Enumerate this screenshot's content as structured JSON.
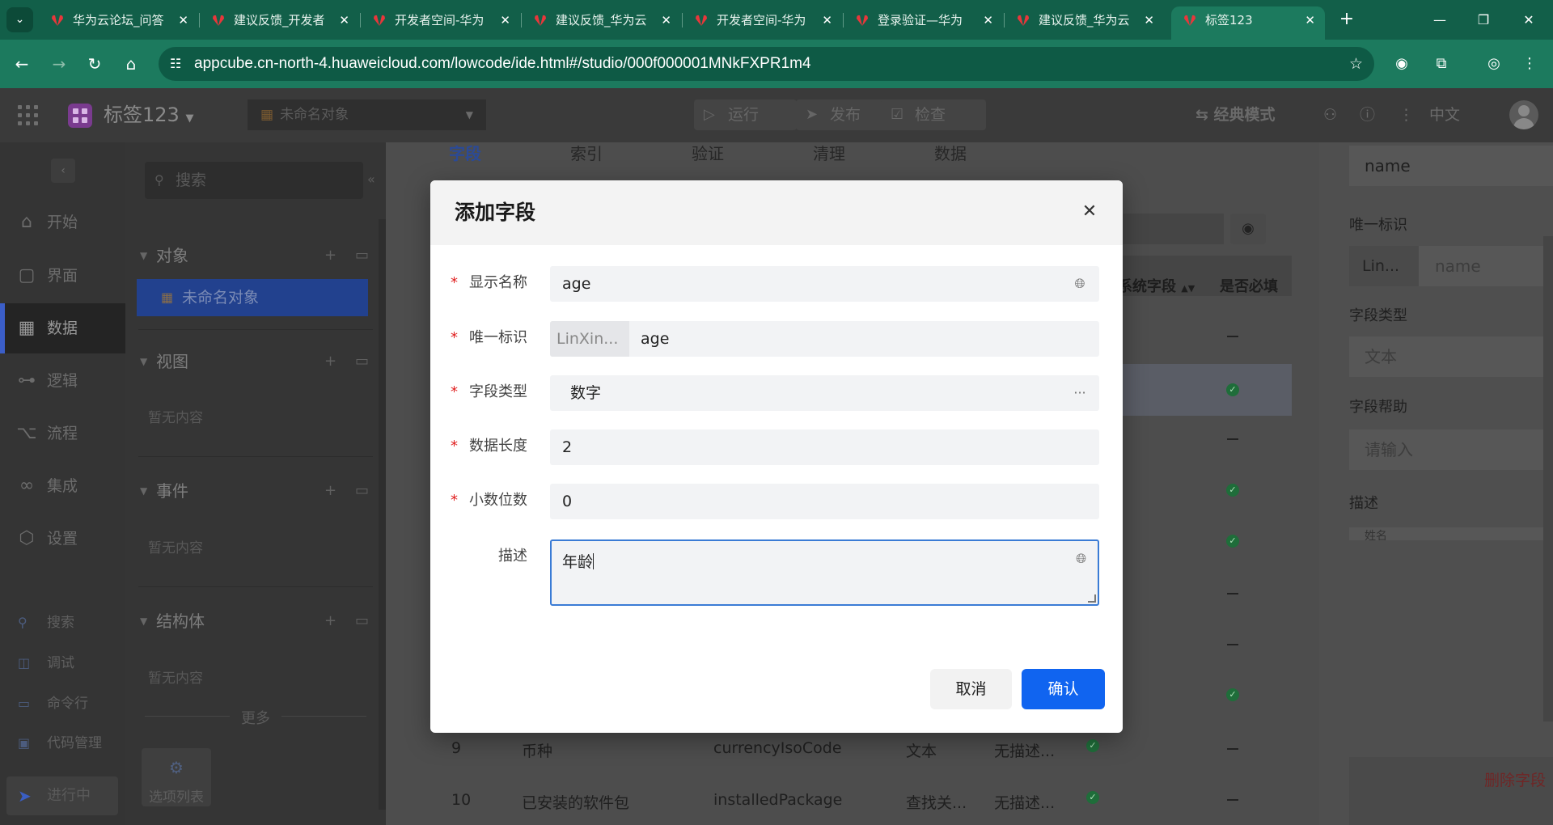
{
  "browser": {
    "tabs": [
      {
        "title": "华为云论坛_问答"
      },
      {
        "title": "建议反馈_开发者"
      },
      {
        "title": "开发者空间-华为"
      },
      {
        "title": "建议反馈_华为云"
      },
      {
        "title": "开发者空间-华为"
      },
      {
        "title": "登录验证—华为"
      },
      {
        "title": "建议反馈_华为云"
      },
      {
        "title": "标签123"
      }
    ],
    "url": "appcube.cn-north-4.huaweicloud.com/lowcode/ide.html#/studio/000f000001MNkFXPR1m4",
    "icons": {
      "back": "back-arrow-icon",
      "forward": "forward-arrow-icon",
      "reload": "reload-icon",
      "home": "home-icon",
      "star": "star-icon"
    }
  },
  "app": {
    "name": "标签123",
    "object_select": "未命名对象",
    "actions": {
      "run": "运行",
      "publish": "发布",
      "check": "检查"
    },
    "mode": "经典模式",
    "language": "中文"
  },
  "rail": {
    "items": [
      {
        "label": "开始",
        "icon": "home-icon"
      },
      {
        "label": "界面",
        "icon": "page-icon"
      },
      {
        "label": "数据",
        "icon": "table-icon"
      },
      {
        "label": "逻辑",
        "icon": "logic-icon"
      },
      {
        "label": "流程",
        "icon": "flow-icon"
      },
      {
        "label": "集成",
        "icon": "link-icon"
      },
      {
        "label": "设置",
        "icon": "settings-icon"
      }
    ],
    "tools": [
      {
        "label": "搜索"
      },
      {
        "label": "调试"
      },
      {
        "label": "命令行"
      },
      {
        "label": "代码管理"
      }
    ],
    "running": "进行中"
  },
  "tree": {
    "search_placeholder": "搜索",
    "sections": {
      "objects": "对象",
      "views": "视图",
      "events": "事件",
      "structs": "结构体"
    },
    "selected_object": "未命名对象",
    "empty": "暂无内容",
    "more": "更多",
    "option_list": "选项列表"
  },
  "main": {
    "tabs": [
      "字段",
      "索引",
      "验证",
      "清理",
      "数据"
    ],
    "columns": {
      "system_field": "系统字段",
      "required": "是否必填"
    },
    "rows": [
      {
        "no": "9",
        "name": "币种",
        "key": "currencyIsoCode",
        "type": "文本",
        "desc": "无描述..."
      },
      {
        "no": "10",
        "name": "已安装的软件包",
        "key": "installedPackage",
        "type": "查找关...",
        "desc": "无描述..."
      }
    ]
  },
  "props": {
    "name_value": "name",
    "unique_label": "唯一标识",
    "unique_prefix": "Lin...",
    "unique_placeholder": "name",
    "type_label": "字段类型",
    "type_value": "文本",
    "help_label": "字段帮助",
    "help_placeholder": "请输入",
    "desc_label": "描述",
    "desc_value": "姓名",
    "delete": "删除字段"
  },
  "dialog": {
    "title": "添加字段",
    "fields": {
      "display_name": {
        "label": "显示名称",
        "value": "age"
      },
      "unique_id": {
        "label": "唯一标识",
        "prefix": "LinXin...",
        "value": "age"
      },
      "field_type": {
        "label": "字段类型",
        "value": "数字"
      },
      "data_length": {
        "label": "数据长度",
        "value": "2"
      },
      "decimals": {
        "label": "小数位数",
        "value": "0"
      },
      "description": {
        "label": "描述",
        "value": "年龄"
      }
    },
    "cancel": "取消",
    "confirm": "确认"
  }
}
